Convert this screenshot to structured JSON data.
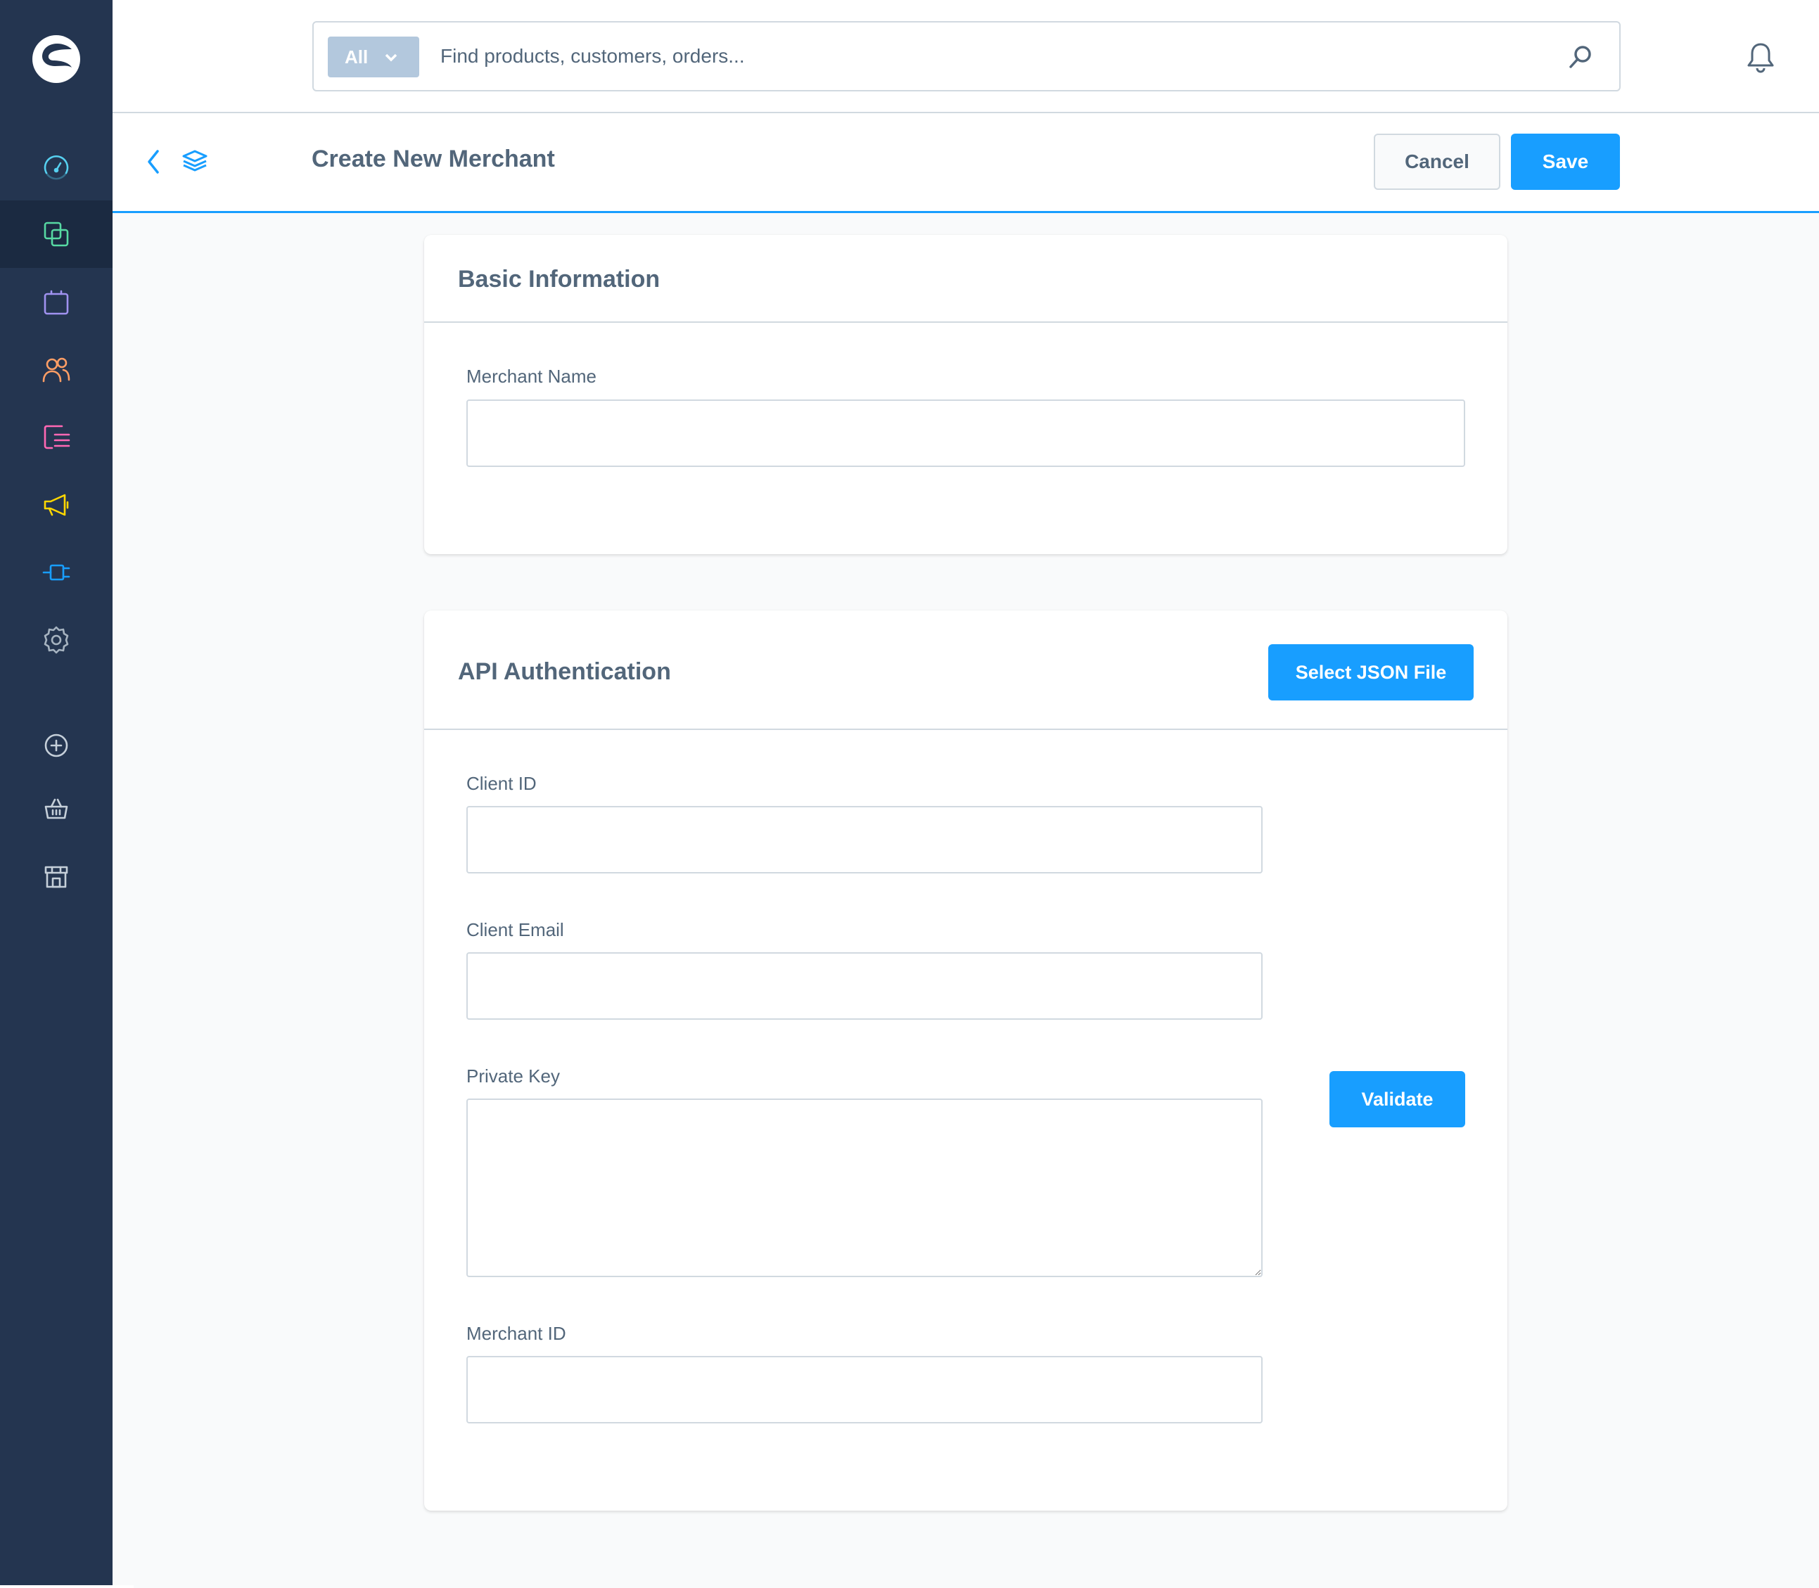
{
  "search": {
    "type_label": "All",
    "placeholder": "Find products, customers, orders..."
  },
  "smartbar": {
    "title": "Create New Merchant",
    "cancel_label": "Cancel",
    "save_label": "Save"
  },
  "basic_info": {
    "title": "Basic Information",
    "merchant_name_label": "Merchant Name",
    "merchant_name_value": ""
  },
  "api_auth": {
    "title": "API Authentication",
    "select_json_label": "Select JSON File",
    "client_id_label": "Client ID",
    "client_id_value": "",
    "client_email_label": "Client Email",
    "client_email_value": "",
    "private_key_label": "Private Key",
    "private_key_value": "",
    "validate_label": "Validate",
    "merchant_id_label": "Merchant ID",
    "merchant_id_value": ""
  },
  "sidebar": {
    "items": [
      {
        "icon": "dashboard-icon",
        "color": "#57d9a3"
      },
      {
        "icon": "catalogues-icon",
        "color": "#57d9a3",
        "active": true
      },
      {
        "icon": "orders-icon",
        "color": "#a092f0"
      },
      {
        "icon": "customers-icon",
        "color": "#ff9e65"
      },
      {
        "icon": "content-icon",
        "color": "#ff68b4"
      },
      {
        "icon": "marketing-icon",
        "color": "#ffd700"
      },
      {
        "icon": "plugins-icon",
        "color": "#189eff"
      },
      {
        "icon": "settings-icon",
        "color": "#9aa8b5"
      },
      {
        "icon": "add-circle-icon",
        "color": "#9aa8b5"
      },
      {
        "icon": "basket-icon",
        "color": "#9aa8b5"
      },
      {
        "icon": "storefront-icon",
        "color": "#9aa8b5"
      }
    ]
  },
  "colors": {
    "primary": "#189eff",
    "sidebar_bg": "#243550",
    "text": "#52667a",
    "border": "#d1d9e0"
  }
}
